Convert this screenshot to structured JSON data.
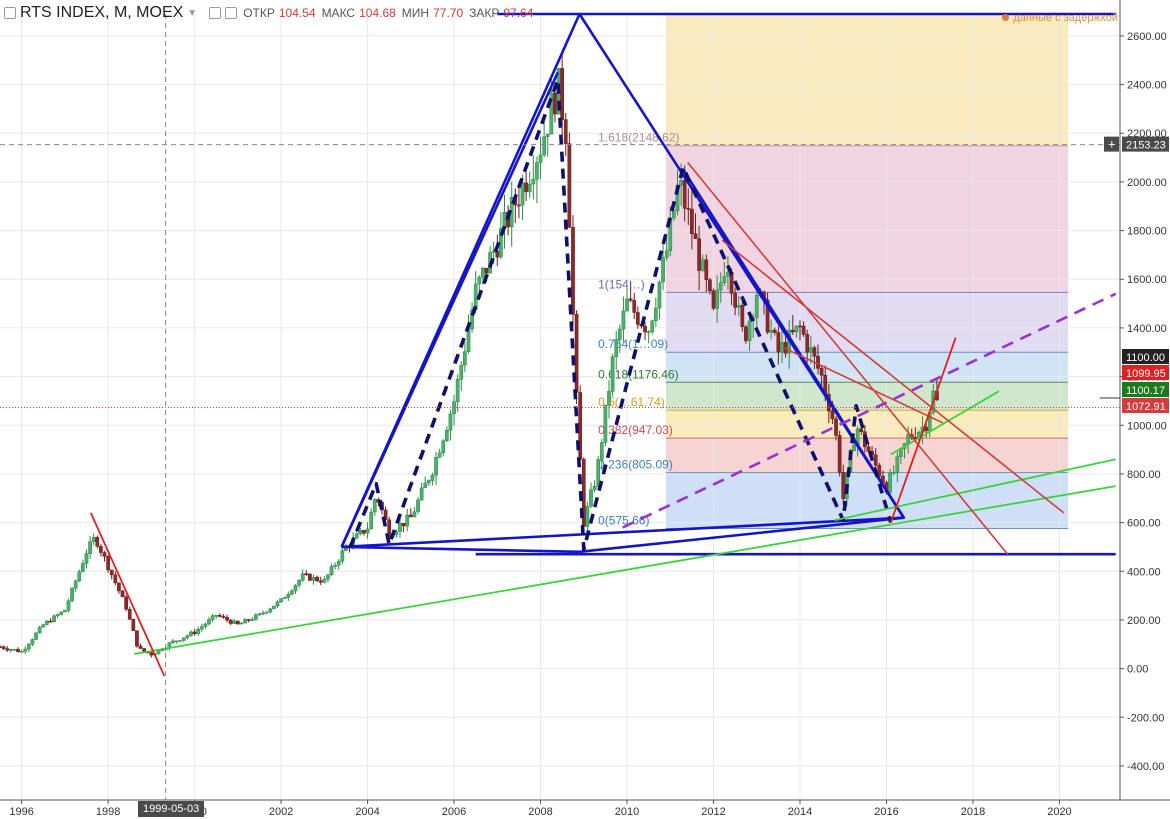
{
  "header": {
    "symbol": "RTS INDEX, M, MOEX",
    "open_label": "ОТКР",
    "open": "104.54",
    "high_label": "МАКС",
    "high": "104.68",
    "low_label": "МИН",
    "low": "77.70",
    "close_label": "ЗАКР",
    "close": "97.64",
    "delay_text": "данные с задержкой"
  },
  "crosshair": {
    "date_label": "1999-05-03",
    "price_label": "2153.23"
  },
  "price_labels": {
    "p1": {
      "text": "1100.00",
      "color": "#222222"
    },
    "p2": {
      "text": "1099.95",
      "color": "#e02020"
    },
    "p3": {
      "text": "1100.17",
      "color": "#1b7a1b"
    },
    "p4": {
      "text": "1072.91",
      "color": "#d23c3c"
    }
  },
  "chart_data": {
    "type": "candlestick",
    "title": "RTS INDEX, M, MOEX",
    "x_ticks": [
      1996,
      1998,
      2000,
      2002,
      2004,
      2006,
      2008,
      2010,
      2012,
      2014,
      2016,
      2018,
      2020
    ],
    "x_tick_labels": [
      "1996",
      "1998",
      "2000",
      "2002",
      "2004",
      "2006",
      "2008",
      "2010",
      "2012",
      "2014",
      "2016",
      "2018",
      "2020"
    ],
    "y_ticks": [
      -400,
      -200,
      0,
      200,
      400,
      600,
      800,
      1000,
      1200,
      1400,
      1600,
      1800,
      2000,
      2200,
      2400,
      2600
    ],
    "y_tick_labels": [
      "-400.00",
      "-200.00",
      "0.00",
      "200.00",
      "400.00",
      "600.00",
      "800.00",
      "1000.00",
      "1200.00",
      "1400.00",
      "1600.00",
      "1800.00",
      "2000.00",
      "2200.00",
      "2400.00",
      "2600.00"
    ],
    "xlim": [
      1995.5,
      2021.4
    ],
    "ylim": [
      -540,
      2690
    ],
    "grid": true,
    "price_series": [
      [
        1995.5,
        90
      ],
      [
        1996.0,
        70
      ],
      [
        1996.5,
        180
      ],
      [
        1997.0,
        240
      ],
      [
        1997.5,
        480
      ],
      [
        1997.7,
        540
      ],
      [
        1998.0,
        420
      ],
      [
        1998.4,
        260
      ],
      [
        1998.7,
        80
      ],
      [
        1999.0,
        60
      ],
      [
        1999.5,
        110
      ],
      [
        2000.0,
        150
      ],
      [
        2000.5,
        220
      ],
      [
        2001.0,
        180
      ],
      [
        2001.5,
        220
      ],
      [
        2002.0,
        280
      ],
      [
        2002.5,
        380
      ],
      [
        2003.0,
        360
      ],
      [
        2003.5,
        500
      ],
      [
        2004.0,
        580
      ],
      [
        2004.2,
        720
      ],
      [
        2004.5,
        560
      ],
      [
        2005.0,
        620
      ],
      [
        2005.5,
        820
      ],
      [
        2006.0,
        1100
      ],
      [
        2006.5,
        1550
      ],
      [
        2007.0,
        1750
      ],
      [
        2007.5,
        1950
      ],
      [
        2008.0,
        2150
      ],
      [
        2008.4,
        2400
      ],
      [
        2008.6,
        2200
      ],
      [
        2008.8,
        1200
      ],
      [
        2009.0,
        600
      ],
      [
        2009.3,
        800
      ],
      [
        2009.7,
        1300
      ],
      [
        2010.0,
        1500
      ],
      [
        2010.5,
        1400
      ],
      [
        2010.9,
        1700
      ],
      [
        2011.2,
        2000
      ],
      [
        2011.5,
        1800
      ],
      [
        2012.0,
        1450
      ],
      [
        2012.3,
        1700
      ],
      [
        2012.7,
        1350
      ],
      [
        2013.0,
        1550
      ],
      [
        2013.5,
        1300
      ],
      [
        2014.0,
        1400
      ],
      [
        2014.5,
        1200
      ],
      [
        2014.8,
        1000
      ],
      [
        2015.0,
        700
      ],
      [
        2015.3,
        1000
      ],
      [
        2015.7,
        850
      ],
      [
        2016.0,
        750
      ],
      [
        2016.2,
        820
      ],
      [
        2016.5,
        950
      ],
      [
        2016.9,
        1000
      ],
      [
        2017.1,
        1140
      ],
      [
        2017.2,
        1070
      ]
    ],
    "fibonacci": {
      "levels": [
        {
          "ratio": "1.618",
          "value": 2148.62,
          "label": "1.618(2148.62)",
          "text_color": "#b08a9a",
          "fill": "#eeccdc"
        },
        {
          "ratio": "1",
          "value": 1546,
          "label": "1(154…)",
          "text_color": "#6a6aaa",
          "fill": "#dcd6ee"
        },
        {
          "ratio": "0.764",
          "value": 1300,
          "label": "0.764(1…09)",
          "text_color": "#3f7fbf",
          "fill": "#c9dff5"
        },
        {
          "ratio": "0.618",
          "value": 1176.46,
          "label": "0.618(1176.46)",
          "text_color": "#2f7a2f",
          "fill": "#c8e3c4"
        },
        {
          "ratio": "0.5",
          "value": 1061.74,
          "label": "0.5(…61.74)",
          "text_color": "#d1a020",
          "fill": "#f9e8b0"
        },
        {
          "ratio": "0.382",
          "value": 947.03,
          "label": "0.382(947.03)",
          "text_color": "#c95050",
          "fill": "#f6cccc"
        },
        {
          "ratio": "0.236",
          "value": 805.09,
          "label": "0.236(805.09)",
          "text_color": "#3f7fbf",
          "fill": "#c6d9f6"
        },
        {
          "ratio": "0",
          "value": 575.66,
          "label": "0(575.66)",
          "text_color": "#3f7fbf",
          "fill": "#c6d9f6"
        }
      ],
      "x_range": [
        2010.9,
        2020.2
      ],
      "top_band": {
        "from": 2148.62,
        "to": 2690,
        "fill": "#f8e6b4"
      }
    },
    "drawings": {
      "triangle_main": {
        "color": "#1515c8",
        "points": [
          [
            2003.4,
            500
          ],
          [
            2008.9,
            2690
          ],
          [
            2016.4,
            620
          ]
        ]
      },
      "channel_top": {
        "color": "#1515c8",
        "points": [
          [
            2003.4,
            500
          ],
          [
            2008.4,
            2450
          ]
        ]
      },
      "base_line": {
        "color": "#1515c8",
        "points": [
          [
            2003.4,
            500
          ],
          [
            2008.9,
            480
          ]
        ]
      },
      "base_line_2": {
        "color": "#1515c8",
        "points": [
          [
            2008.9,
            480
          ],
          [
            2016.4,
            620
          ]
        ]
      },
      "top_horizontal": {
        "color": "#1515c8",
        "points": [
          [
            2007.0,
            2690
          ],
          [
            2021.3,
            2690
          ]
        ]
      },
      "bottom_horizontal": {
        "color": "#1515c8",
        "points": [
          [
            2006.5,
            470
          ],
          [
            2021.3,
            470
          ]
        ]
      },
      "falling_line": {
        "color": "#1515c8",
        "points": [
          [
            2011.3,
            2050
          ],
          [
            2016.4,
            620
          ]
        ]
      },
      "zigzag_dashed": {
        "color": "#10106a",
        "points": [
          [
            2003.6,
            500
          ],
          [
            2004.2,
            760
          ],
          [
            2004.5,
            510
          ],
          [
            2008.4,
            2420
          ],
          [
            2009.0,
            490
          ],
          [
            2011.3,
            2060
          ],
          [
            2015.0,
            610
          ],
          [
            2015.3,
            1080
          ],
          [
            2016.1,
            600
          ],
          [
            2016.1,
            600
          ]
        ]
      },
      "purple_dashed": {
        "color": "#9a30d6",
        "points": [
          [
            2009.9,
            580
          ],
          [
            2021.3,
            1540
          ]
        ]
      },
      "green_1": {
        "color": "#3ad43a",
        "points": [
          [
            1998.6,
            60
          ],
          [
            2021.3,
            750
          ]
        ]
      },
      "green_2": {
        "color": "#3ad43a",
        "points": [
          [
            2014.8,
            610
          ],
          [
            2021.3,
            860
          ]
        ]
      },
      "green_3": {
        "color": "#3ad43a",
        "points": [
          [
            2016.1,
            880
          ],
          [
            2018.6,
            1140
          ]
        ]
      },
      "red_1": {
        "color": "#e02020",
        "points": [
          [
            1997.6,
            640
          ],
          [
            1999.3,
            -30
          ]
        ]
      },
      "red_2": {
        "color": "#d23c3c",
        "points": [
          [
            2011.4,
            2080
          ],
          [
            2018.8,
            470
          ]
        ]
      },
      "red_3": {
        "color": "#d23c3c",
        "points": [
          [
            2012.2,
            1760
          ],
          [
            2020.1,
            640
          ]
        ]
      },
      "red_4": {
        "color": "#d23c3c",
        "points": [
          [
            2013.6,
            1320
          ],
          [
            2017.3,
            1010
          ]
        ]
      },
      "red_rise": {
        "color": "#e02020",
        "points": [
          [
            2016.1,
            600
          ],
          [
            2017.6,
            1360
          ]
        ]
      }
    }
  }
}
